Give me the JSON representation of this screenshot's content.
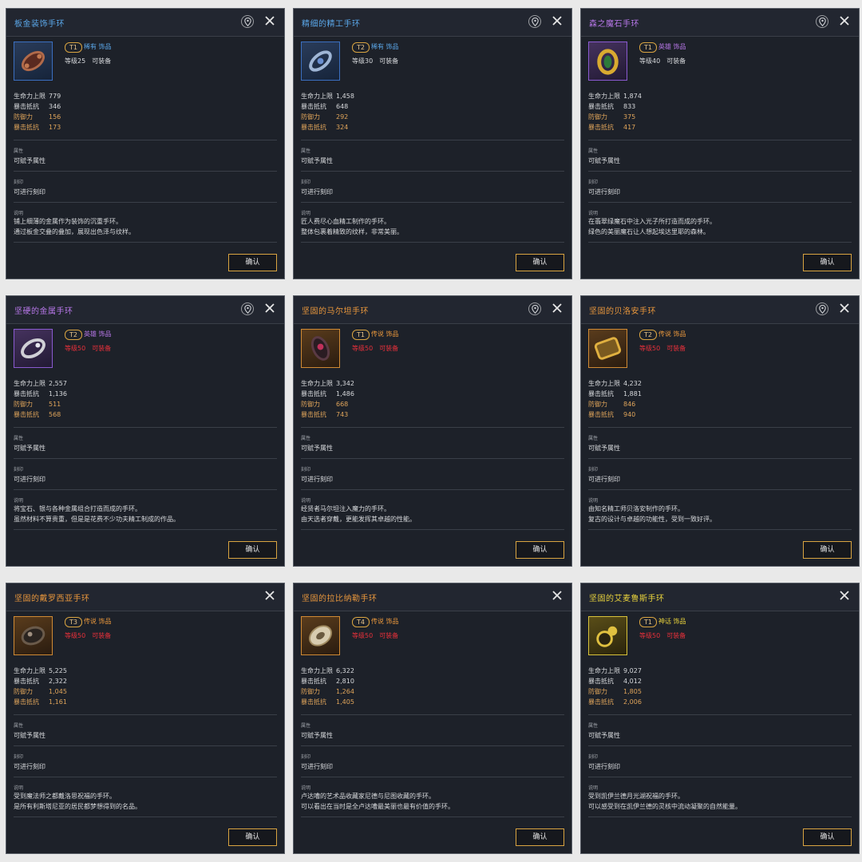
{
  "labels": {
    "attr": "属性",
    "attr_value": "可赋予属性",
    "engrave": "刻印",
    "engrave_value": "可进行刻印",
    "desc": "说明",
    "confirm": "确认"
  },
  "colors": {
    "rare": "#5aa6e8",
    "heroic": "#b777e8",
    "legend": "#e8963c",
    "myth": "#e8d23c",
    "requirement_met": "#d7d9dc",
    "requirement_unmet": "#e8303a",
    "stat_highlight": "#dfa45a"
  },
  "cards": [
    {
      "title": "板金装饰手环",
      "tier": "T1",
      "rarity_text": "稀有 饰品",
      "rarity": "rare",
      "level_text": "等级25",
      "equip_text": "可装备",
      "requirement_met": true,
      "icon": "metal-bracelet-icon",
      "has_pin": true,
      "stats": [
        {
          "label": "生命力上限",
          "value": "779",
          "highlight": false
        },
        {
          "label": "暴击抵抗",
          "value": "346",
          "highlight": false
        },
        {
          "label": "防御力",
          "value": "156",
          "highlight": true
        },
        {
          "label": "暴击抵抗",
          "value": "173",
          "highlight": true
        }
      ],
      "desc": [
        "铺上细薄的金属作为装饰的沉重手环。",
        "通过板金交叠的叠加，展现出色泽与纹样。"
      ]
    },
    {
      "title": "精细的精工手环",
      "tier": "T2",
      "rarity_text": "稀有 饰品",
      "rarity": "rare",
      "level_text": "等级30",
      "equip_text": "可装备",
      "requirement_met": true,
      "icon": "crafted-bracelet-icon",
      "has_pin": true,
      "stats": [
        {
          "label": "生命力上限",
          "value": "1,458",
          "highlight": false
        },
        {
          "label": "暴击抵抗",
          "value": "648",
          "highlight": false
        },
        {
          "label": "防御力",
          "value": "292",
          "highlight": true
        },
        {
          "label": "暴击抵抗",
          "value": "324",
          "highlight": true
        }
      ],
      "desc": [
        "匠人费尽心血精工制作的手环。",
        "整体包裹着精致的纹样，非常美丽。"
      ]
    },
    {
      "title": "森之魔石手环",
      "tier": "T1",
      "rarity_text": "英雄 饰品",
      "rarity": "heroic",
      "level_text": "等级40",
      "equip_text": "可装备",
      "requirement_met": true,
      "icon": "green-gem-ring-icon",
      "has_pin": true,
      "stats": [
        {
          "label": "生命力上限",
          "value": "1,874",
          "highlight": false
        },
        {
          "label": "暴击抵抗",
          "value": "833",
          "highlight": false
        },
        {
          "label": "防御力",
          "value": "375",
          "highlight": true
        },
        {
          "label": "暴击抵抗",
          "value": "417",
          "highlight": true
        }
      ],
      "desc": [
        "在翡翠绿魔石中注入光子所打造而成的手环。",
        "绿色的美丽魔石让人想起埃达里耶的森林。"
      ]
    },
    {
      "title": "坚硬的金属手环",
      "tier": "T2",
      "rarity_text": "英雄 饰品",
      "rarity": "heroic",
      "level_text": "等级50",
      "equip_text": "可装备",
      "requirement_met": false,
      "icon": "silver-bracelet-icon",
      "has_pin": true,
      "stats": [
        {
          "label": "生命力上限",
          "value": "2,557",
          "highlight": false
        },
        {
          "label": "暴击抵抗",
          "value": "1,136",
          "highlight": false
        },
        {
          "label": "防御力",
          "value": "511",
          "highlight": true
        },
        {
          "label": "暴击抵抗",
          "value": "568",
          "highlight": true
        }
      ],
      "desc": [
        "将宝石、银与各种金属组合打造而成的手环。",
        "虽然材料不算贵重，但是是花费不少功夫精工制成的作品。"
      ]
    },
    {
      "title": "坚固的马尔坦手环",
      "tier": "T1",
      "rarity_text": "传说 饰品",
      "rarity": "legend",
      "level_text": "等级50",
      "equip_text": "可装备",
      "requirement_met": false,
      "icon": "dark-ruby-bracelet-icon",
      "has_pin": true,
      "stats": [
        {
          "label": "生命力上限",
          "value": "3,342",
          "highlight": false
        },
        {
          "label": "暴击抵抗",
          "value": "1,486",
          "highlight": false
        },
        {
          "label": "防御力",
          "value": "668",
          "highlight": true
        },
        {
          "label": "暴击抵抗",
          "value": "743",
          "highlight": true
        }
      ],
      "desc": [
        "经贤者马尔坦注入魔力的手环。",
        "由天选者穿戴，更能发挥其卓越的性能。"
      ]
    },
    {
      "title": "坚固的贝洛安手环",
      "tier": "T2",
      "rarity_text": "传说 饰品",
      "rarity": "legend",
      "level_text": "等级50",
      "equip_text": "可装备",
      "requirement_met": false,
      "icon": "gold-bracelet-icon",
      "has_pin": true,
      "stats": [
        {
          "label": "生命力上限",
          "value": "4,232",
          "highlight": false
        },
        {
          "label": "暴击抵抗",
          "value": "1,881",
          "highlight": false
        },
        {
          "label": "防御力",
          "value": "846",
          "highlight": true
        },
        {
          "label": "暴击抵抗",
          "value": "940",
          "highlight": true
        }
      ],
      "desc": [
        "由知名精工师贝洛安制作的手环。",
        "复古的设计与卓越的功能性，受到一致好评。"
      ]
    },
    {
      "title": "坚固的戴罗西亚手环",
      "tier": "T3",
      "rarity_text": "传说 饰品",
      "rarity": "legend",
      "level_text": "等级50",
      "equip_text": "可装备",
      "requirement_met": false,
      "icon": "dark-stone-bracelet-icon",
      "has_pin": false,
      "stats": [
        {
          "label": "生命力上限",
          "value": "5,225",
          "highlight": false
        },
        {
          "label": "暴击抵抗",
          "value": "2,322",
          "highlight": false
        },
        {
          "label": "防御力",
          "value": "1,045",
          "highlight": true
        },
        {
          "label": "暴击抵抗",
          "value": "1,161",
          "highlight": true
        }
      ],
      "desc": [
        "受到魔法师之都戴洛思祝福的手环。",
        "是所有利斯塔尼亚的居民都梦想得到的名品。"
      ]
    },
    {
      "title": "坚固的拉比纳勒手环",
      "tier": "T4",
      "rarity_text": "传说 饰品",
      "rarity": "legend",
      "level_text": "等级50",
      "equip_text": "可装备",
      "requirement_met": false,
      "icon": "pearl-bracelet-icon",
      "has_pin": false,
      "stats": [
        {
          "label": "生命力上限",
          "value": "6,322",
          "highlight": false
        },
        {
          "label": "暴击抵抗",
          "value": "2,810",
          "highlight": false
        },
        {
          "label": "防御力",
          "value": "1,264",
          "highlight": true
        },
        {
          "label": "暴击抵抗",
          "value": "1,405",
          "highlight": true
        }
      ],
      "desc": [
        "卢达嘈的艺术品收藏家尼德与尼图收藏的手环。",
        "可以看出在当时是全卢达嘈最美丽也最有价值的手环。"
      ]
    },
    {
      "title": "坚固的艾麦鲁斯手环",
      "tier": "T1",
      "rarity_text": "神话 饰品",
      "rarity": "myth",
      "level_text": "等级50",
      "equip_text": "可装备",
      "requirement_met": false,
      "icon": "golden-amber-bracelet-icon",
      "has_pin": false,
      "stats": [
        {
          "label": "生命力上限",
          "value": "9,027",
          "highlight": false
        },
        {
          "label": "暴击抵抗",
          "value": "4,012",
          "highlight": false
        },
        {
          "label": "防御力",
          "value": "1,805",
          "highlight": true
        },
        {
          "label": "暴击抵抗",
          "value": "2,006",
          "highlight": true
        }
      ],
      "desc": [
        "受到凯伊兰德月光湖祝福的手环。",
        "可以感受到在凯伊兰德的灵核中流动凝聚的自然能量。"
      ]
    }
  ]
}
